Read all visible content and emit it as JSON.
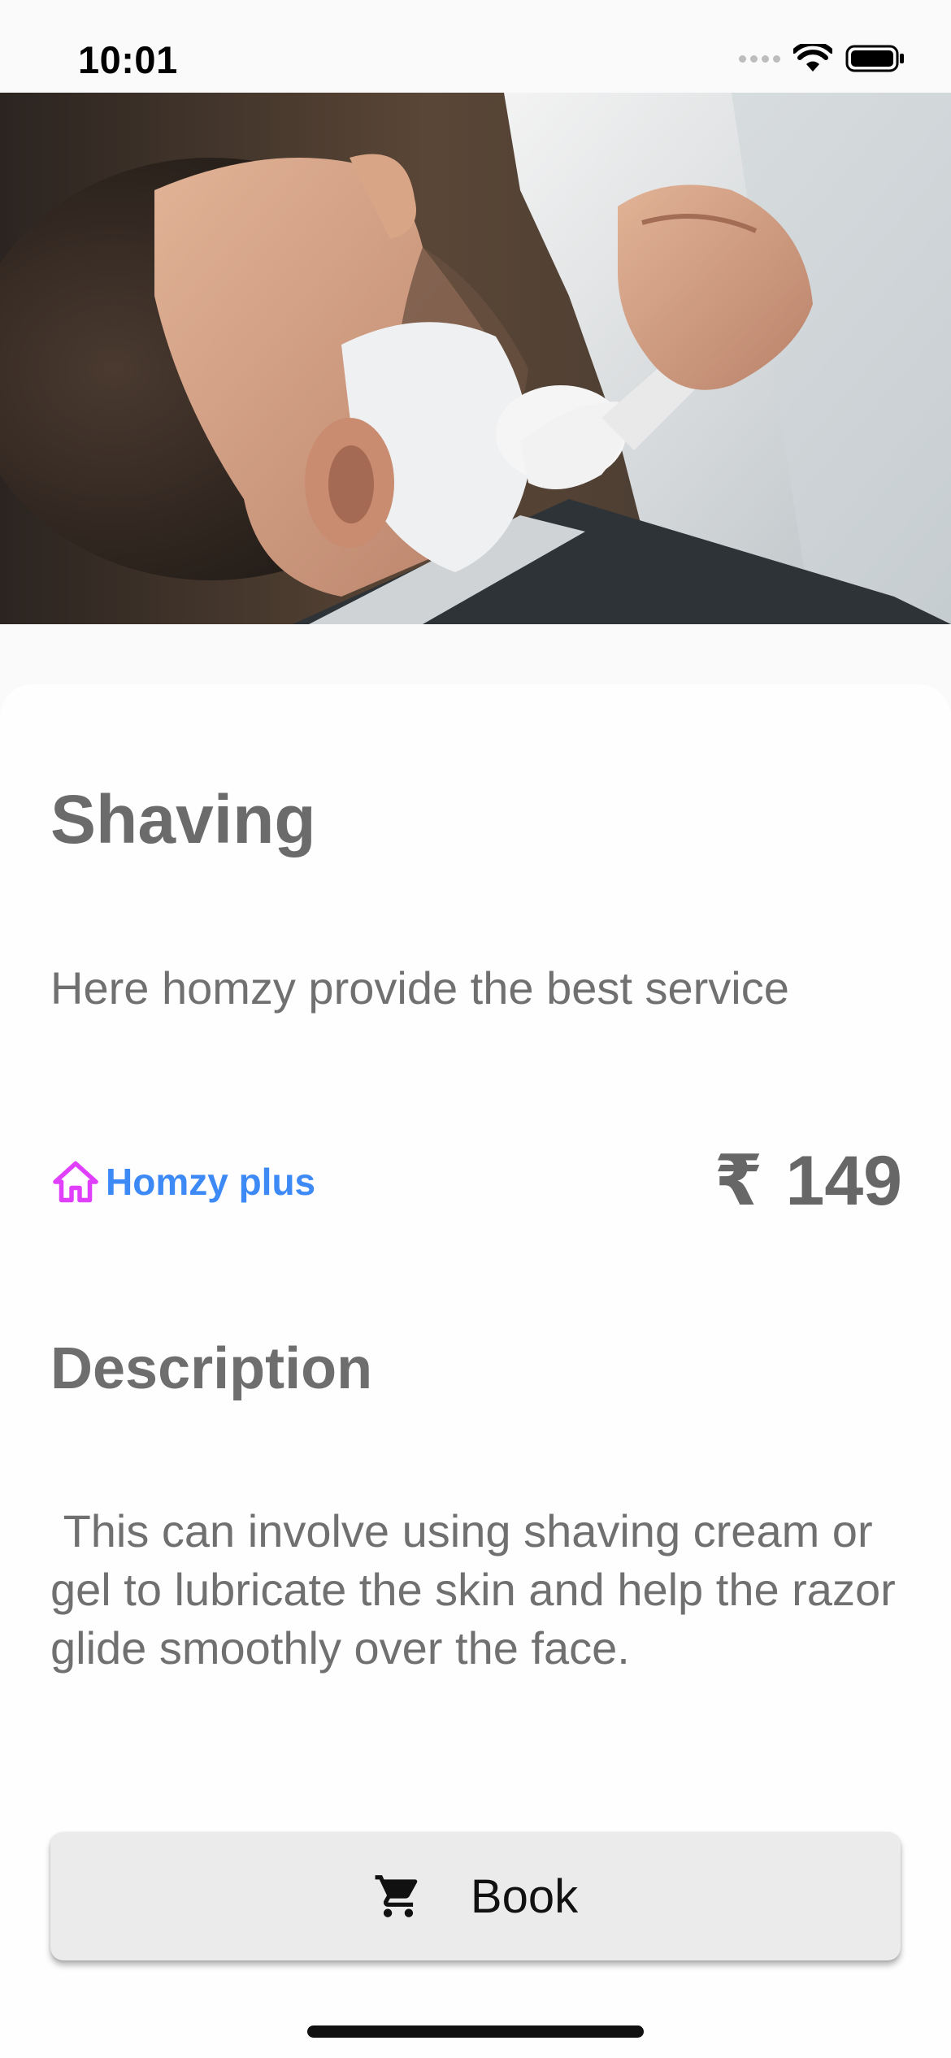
{
  "status_bar": {
    "time": "10:01",
    "icons": [
      "cellular-signal-icon",
      "wifi-icon",
      "battery-icon"
    ]
  },
  "hero": {
    "icon": "barber-shaving-photo"
  },
  "service": {
    "title": "Shaving",
    "subtitle": "Here homzy provide the best service"
  },
  "membership": {
    "label": "Homzy plus",
    "icon": "home-icon",
    "icon_color": "#e040fb",
    "label_color": "#3d8af7"
  },
  "price": {
    "currency_symbol": "₹",
    "amount": "149"
  },
  "description": {
    "heading": "Description",
    "text": " This can involve using shaving cream or gel to lubricate the skin and help the razor glide smoothly over the face."
  },
  "book_button": {
    "label": "Book",
    "icon": "shopping-cart-icon"
  }
}
